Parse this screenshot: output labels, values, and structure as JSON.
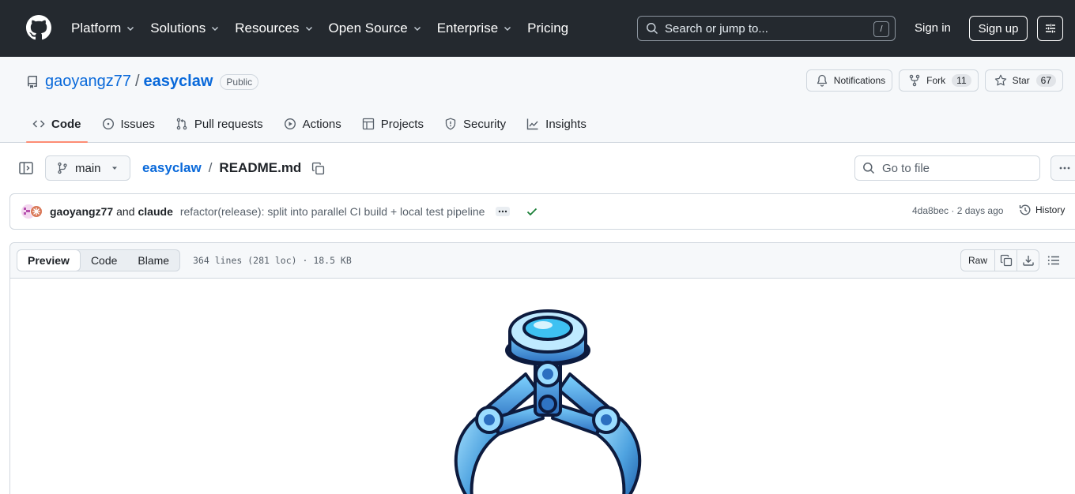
{
  "header": {
    "nav": [
      "Platform",
      "Solutions",
      "Resources",
      "Open Source",
      "Enterprise",
      "Pricing"
    ],
    "search_placeholder": "Search or jump to...",
    "search_shortcut": "/",
    "sign_in": "Sign in",
    "sign_up": "Sign up"
  },
  "repo": {
    "owner": "gaoyangz77",
    "separator": "/",
    "name": "easyclaw",
    "visibility": "Public",
    "notifications_label": "Notifications",
    "fork_label": "Fork",
    "fork_count": "11",
    "star_label": "Star",
    "star_count": "67",
    "tabs": [
      {
        "label": "Code",
        "icon": "code-icon",
        "active": true
      },
      {
        "label": "Issues",
        "icon": "issue-icon"
      },
      {
        "label": "Pull requests",
        "icon": "pull-request-icon"
      },
      {
        "label": "Actions",
        "icon": "play-icon"
      },
      {
        "label": "Projects",
        "icon": "table-icon"
      },
      {
        "label": "Security",
        "icon": "shield-icon"
      },
      {
        "label": "Insights",
        "icon": "graph-icon"
      }
    ]
  },
  "filebar": {
    "branch": "main",
    "repo_crumb": "easyclaw",
    "crumb_sep": "/",
    "file_name": "README.md",
    "goto_placeholder": "Go to file"
  },
  "commit": {
    "author1": "gaoyangz77",
    "and_text": "and",
    "author2": "claude",
    "message": "refactor(release): split into parallel CI build + local test pipeline",
    "meta": "4da8bec · 2 days ago",
    "history_label": "History"
  },
  "viewer": {
    "modes": [
      "Preview",
      "Code",
      "Blame"
    ],
    "info": "364 lines (281 loc) · 18.5 KB",
    "raw_label": "Raw"
  },
  "colors": {
    "header_bg": "#24292f",
    "link": "#0969da",
    "active_tab_underline": "#fd8c73",
    "success": "#1a7f37"
  }
}
